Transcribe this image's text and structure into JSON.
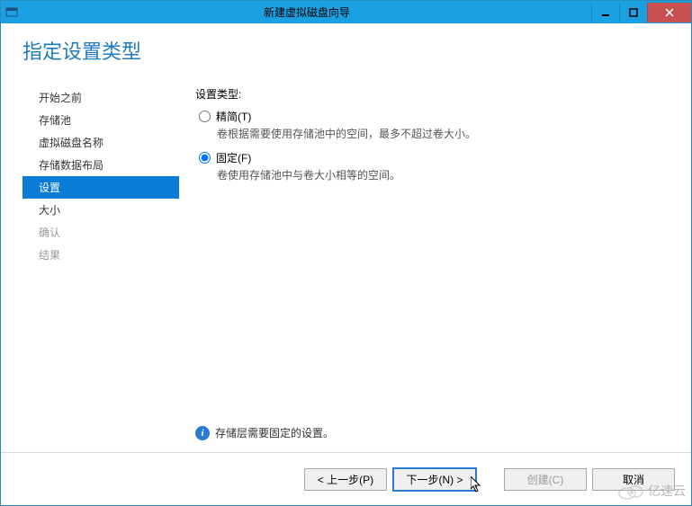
{
  "window": {
    "title": "新建虚拟磁盘向导"
  },
  "header": {
    "title": "指定设置类型"
  },
  "sidebar": {
    "items": [
      {
        "label": "开始之前"
      },
      {
        "label": "存储池"
      },
      {
        "label": "虚拟磁盘名称"
      },
      {
        "label": "存储数据布局"
      },
      {
        "label": "设置"
      },
      {
        "label": "大小"
      },
      {
        "label": "确认"
      },
      {
        "label": "结果"
      }
    ]
  },
  "main": {
    "group_title": "设置类型:",
    "options": [
      {
        "label": "精简(T)",
        "desc": "卷根据需要使用存储池中的空间，最多不超过卷大小。"
      },
      {
        "label": "固定(F)",
        "desc": "卷使用存储池中与卷大小相等的空间。"
      }
    ],
    "info": "存储层需要固定的设置。"
  },
  "footer": {
    "prev": "< 上一步(P)",
    "next": "下一步(N) >",
    "create": "创建(C)",
    "cancel": "取消"
  },
  "watermark": {
    "text": "亿速云"
  }
}
